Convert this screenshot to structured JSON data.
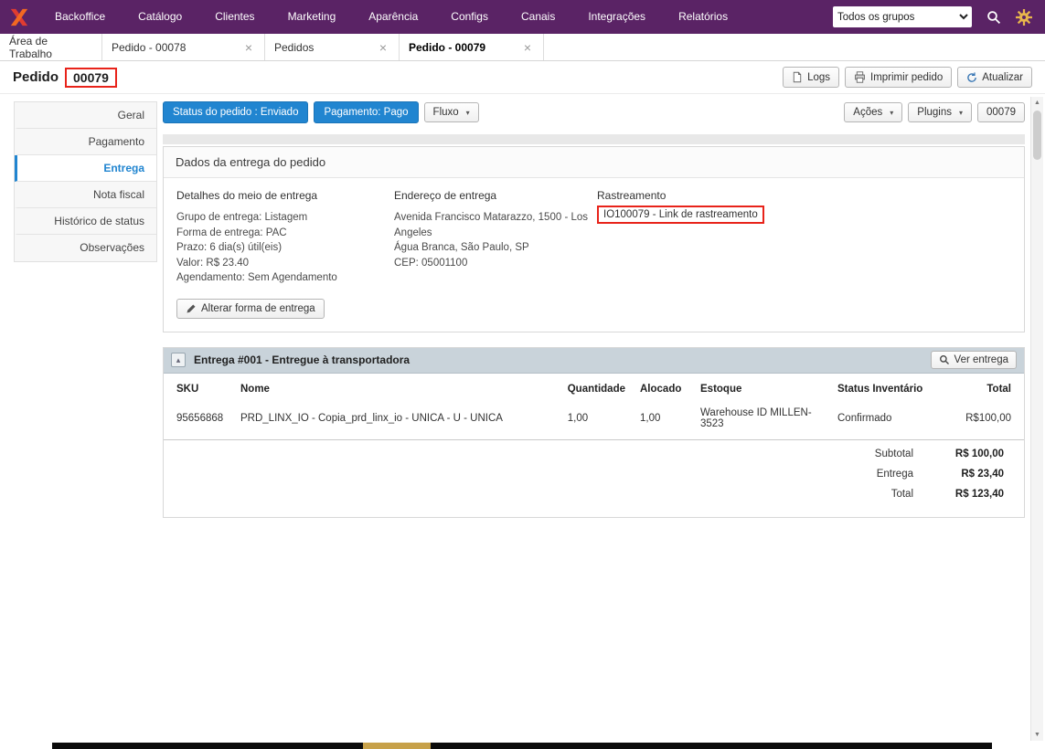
{
  "topnav": {
    "items": [
      "Backoffice",
      "Catálogo",
      "Clientes",
      "Marketing",
      "Aparência",
      "Configs",
      "Canais",
      "Integrações",
      "Relatórios"
    ],
    "group_select": "Todos os grupos"
  },
  "tabs": [
    {
      "label": "Área de Trabalho"
    },
    {
      "label": "Pedido - 00078"
    },
    {
      "label": "Pedidos"
    },
    {
      "label": "Pedido - 00079"
    }
  ],
  "page": {
    "title": "Pedido",
    "order_number": "00079",
    "logs_button": "Logs",
    "print_button": "Imprimir pedido",
    "refresh_button": "Atualizar"
  },
  "sidebar": {
    "items": [
      "Geral",
      "Pagamento",
      "Entrega",
      "Nota fiscal",
      "Histórico de status",
      "Observações"
    ]
  },
  "toolbar": {
    "order_status": "Status do pedido : Enviado",
    "payment_status": "Pagamento: Pago",
    "flow_button": "Fluxo",
    "actions_button": "Ações",
    "plugins_button": "Plugins",
    "order_code": "00079"
  },
  "delivery": {
    "panel_title": "Dados da entrega do pedido",
    "details_heading": "Detalhes do meio de entrega",
    "details_lines": [
      "Grupo de entrega: Listagem",
      "Forma de entrega: PAC",
      "Prazo: 6 dia(s) útil(eis)",
      "Valor: R$ 23.40",
      "Agendamento: Sem Agendamento"
    ],
    "address_heading": "Endereço de entrega",
    "address_lines": [
      "Avenida Francisco Matarazzo, 1500 - Los Angeles",
      "Água Branca, São Paulo, SP",
      "CEP: 05001100"
    ],
    "tracking_heading": "Rastreamento",
    "tracking_link": "IO100079 - Link de rastreamento",
    "change_button": "Alterar forma de entrega"
  },
  "shipment": {
    "panel_title": "Entrega #001 - Entregue à transportadora",
    "view_button": "Ver entrega",
    "table": {
      "headers": [
        "SKU",
        "Nome",
        "Quantidade",
        "Alocado",
        "Estoque",
        "Status Inventário",
        "Total"
      ],
      "rows": [
        {
          "sku": "95656868",
          "nome": "PRD_LINX_IO - Copia_prd_linx_io - UNICA - U - UNICA",
          "quantidade": "1,00",
          "alocado": "1,00",
          "estoque": "Warehouse ID MILLEN-3523",
          "status": "Confirmado",
          "total": "R$100,00"
        }
      ],
      "summary": [
        {
          "label": "Subtotal",
          "value": "R$ 100,00"
        },
        {
          "label": "Entrega",
          "value": "R$ 23,40"
        },
        {
          "label": "Total",
          "value": "R$ 123,40"
        }
      ]
    }
  },
  "icons": {
    "close": "×",
    "caret": "▾",
    "collapse": "▴",
    "scroll_up": "▲",
    "scroll_down": "▼"
  },
  "colors": {
    "topnav_purple": "#5a2365",
    "accent_blue": "#2185d0",
    "annotation_red": "#e8231a",
    "panel_header_gray": "#c9d3da"
  }
}
